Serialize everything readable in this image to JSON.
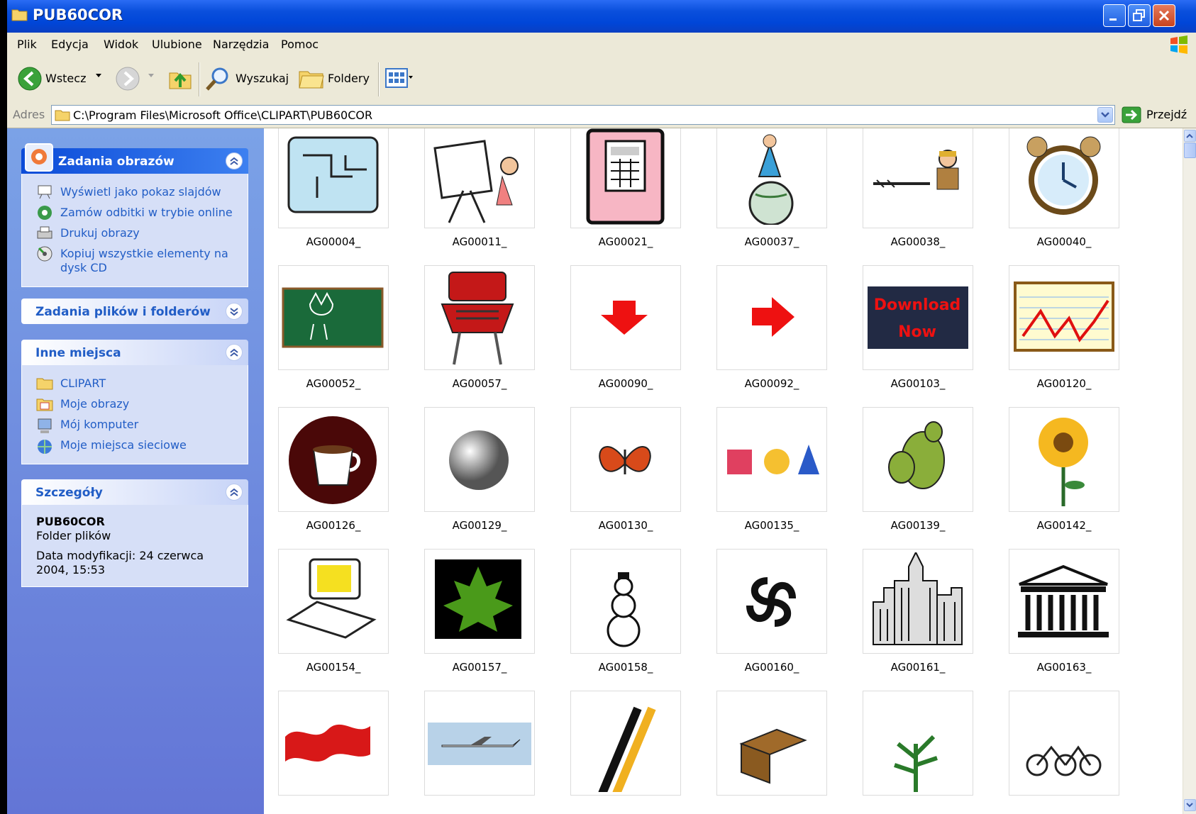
{
  "window": {
    "title": "PUB60COR"
  },
  "menu": [
    "Plik",
    "Edycja",
    "Widok",
    "Ulubione",
    "Narzędzia",
    "Pomoc"
  ],
  "toolbar": {
    "back": "Wstecz",
    "search": "Wyszukaj",
    "folders": "Foldery"
  },
  "address": {
    "label": "Adres",
    "path": "C:\\Program Files\\Microsoft Office\\CLIPART\\PUB60COR",
    "go": "Przejdź"
  },
  "tasks": {
    "image_tasks": {
      "title": "Zadania obrazów",
      "items": [
        "Wyświetl jako pokaz slajdów",
        "Zamów odbitki w trybie online",
        "Drukuj obrazy",
        "Kopiuj wszystkie elementy na",
        "dysk CD"
      ]
    },
    "file_tasks": {
      "title": "Zadania plików i folderów"
    },
    "other_places": {
      "title": "Inne miejsca",
      "items": [
        "CLIPART",
        "Moje obrazy",
        "Mój komputer",
        "Moje miejsca sieciowe"
      ]
    },
    "details": {
      "title": "Szczegóły",
      "name": "PUB60COR",
      "type": "Folder plików",
      "modified_1": "Data modyfikacji: 24 czerwca",
      "modified_2": "2004, 15:53"
    }
  },
  "files": [
    {
      "name": "AG00004_",
      "icon": "map-icon"
    },
    {
      "name": "AG00011_",
      "icon": "drafting-table-icon"
    },
    {
      "name": "AG00021_",
      "icon": "calculator-icon"
    },
    {
      "name": "AG00037_",
      "icon": "businessman-globe-icon"
    },
    {
      "name": "AG00038_",
      "icon": "worker-drill-icon"
    },
    {
      "name": "AG00040_",
      "icon": "alarm-clock-icon"
    },
    {
      "name": "AG00052_",
      "icon": "chalkboard-cat-icon"
    },
    {
      "name": "AG00057_",
      "icon": "barbecue-grill-icon"
    },
    {
      "name": "AG00090_",
      "icon": "red-arrow-down-icon"
    },
    {
      "name": "AG00092_",
      "icon": "red-arrow-right-icon"
    },
    {
      "name": "AG00103_",
      "icon": "download-now-banner-icon"
    },
    {
      "name": "AG00120_",
      "icon": "line-graph-icon"
    },
    {
      "name": "AG00126_",
      "icon": "coffee-cup-icon"
    },
    {
      "name": "AG00129_",
      "icon": "silver-ball-icon"
    },
    {
      "name": "AG00130_",
      "icon": "butterfly-icon"
    },
    {
      "name": "AG00135_",
      "icon": "shapes-icon"
    },
    {
      "name": "AG00139_",
      "icon": "cactus-icon"
    },
    {
      "name": "AG00142_",
      "icon": "sunflower-icon"
    },
    {
      "name": "AG00154_",
      "icon": "computer-icon"
    },
    {
      "name": "AG00157_",
      "icon": "maple-leaf-icon"
    },
    {
      "name": "AG00158_",
      "icon": "snowman-icon"
    },
    {
      "name": "AG00160_",
      "icon": "spiral-icon"
    },
    {
      "name": "AG00161_",
      "icon": "city-skyline-icon"
    },
    {
      "name": "AG00163_",
      "icon": "greek-temple-icon"
    },
    {
      "name": "",
      "icon": "dragon-icon"
    },
    {
      "name": "",
      "icon": "airplane-icon"
    },
    {
      "name": "",
      "icon": "skis-icon"
    },
    {
      "name": "",
      "icon": "open-box-icon"
    },
    {
      "name": "",
      "icon": "plant-icon"
    },
    {
      "name": "",
      "icon": "bicycles-icon"
    }
  ],
  "colors": {
    "titlebar": "#0046d8",
    "taskpane": "#6b8ee0",
    "link": "#215dc6",
    "chrome": "#ece9d8"
  }
}
